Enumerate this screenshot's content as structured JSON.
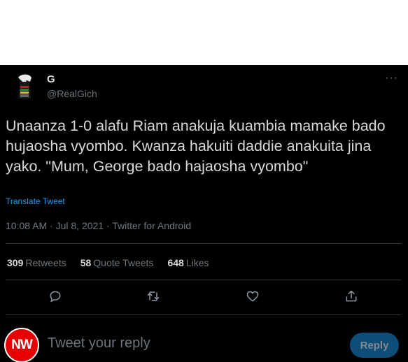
{
  "tweet": {
    "author_name": "G",
    "author_handle": "@RealGich",
    "more_label": "···",
    "text": "Unaanza 1-0 alafu Riam anakuja kuambia mamake bado hujaosha vyombo. Kwanza hakuiti daddie anakuita jina yako. \"Mum, George bado hajaosha vyombo\"",
    "translate_label": "Translate Tweet",
    "meta": "10:08 AM · Jul 8, 2021 · Twitter for Android"
  },
  "stats": {
    "retweets_count": "309",
    "retweets_label": "Retweets",
    "quotes_count": "58",
    "quotes_label": "Quote Tweets",
    "likes_count": "648",
    "likes_label": "Likes"
  },
  "actions": [
    {
      "icon": "reply-icon"
    },
    {
      "icon": "retweet-icon"
    },
    {
      "icon": "heart-icon"
    },
    {
      "icon": "share-icon"
    }
  ],
  "reply": {
    "logo_text": "NW",
    "placeholder": "Tweet your reply",
    "button_label": "Reply"
  },
  "colors": {
    "background": "#000000",
    "text": "#d9d9d9",
    "muted": "#6e767d",
    "link": "#1d9bf0",
    "reply_button": "#0e4d78",
    "logo": "#e60000"
  }
}
